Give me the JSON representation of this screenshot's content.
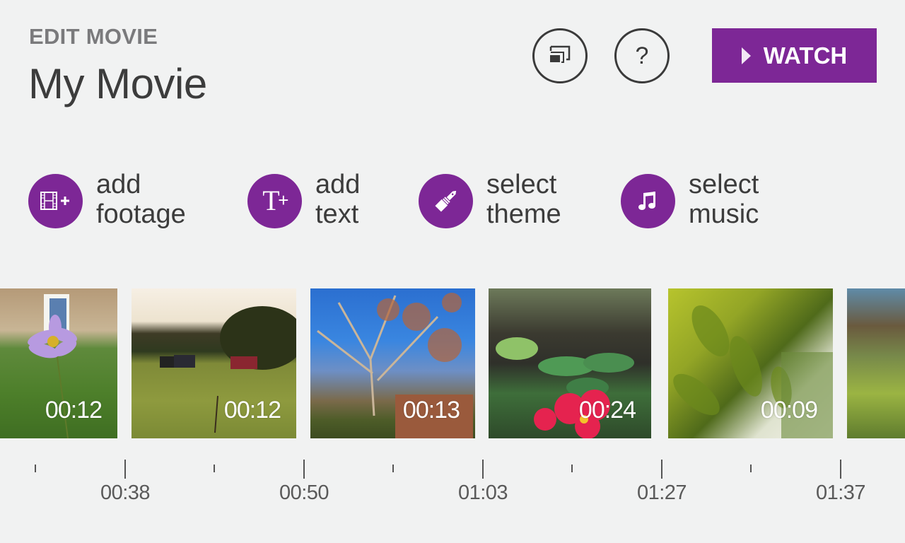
{
  "header": {
    "kicker": "EDIT MOVIE",
    "title": "My Movie"
  },
  "toolbar": {
    "project_icon": "project-to-screen-icon",
    "help_icon": "help-icon",
    "help_glyph": "?",
    "watch_label": "WATCH",
    "watch_icon": "play-icon"
  },
  "accent_color": "#7d2796",
  "actions": [
    {
      "line1": "add",
      "line2": "footage",
      "icon": "add-footage-icon"
    },
    {
      "line1": "add",
      "line2": "text",
      "icon": "add-text-icon",
      "glyph": "T",
      "glyph_plus": "+"
    },
    {
      "line1": "select",
      "line2": "theme",
      "icon": "paintbrush-icon"
    },
    {
      "line1": "select",
      "line2": "music",
      "icon": "music-note-icon",
      "glyph": "♫"
    }
  ],
  "clips": [
    {
      "duration": "00:12",
      "subject": "purple flower in garden"
    },
    {
      "duration": "00:12",
      "subject": "horses in field"
    },
    {
      "duration": "00:13",
      "subject": "bare tree against blue sky"
    },
    {
      "duration": "00:24",
      "subject": "red primrose"
    },
    {
      "duration": "00:09",
      "subject": "sunlit green leaves"
    },
    {
      "duration": "",
      "subject": "garden hedge"
    }
  ],
  "timeline": {
    "labels": [
      "00:38",
      "00:50",
      "01:03",
      "01:27",
      "01:37"
    ]
  }
}
